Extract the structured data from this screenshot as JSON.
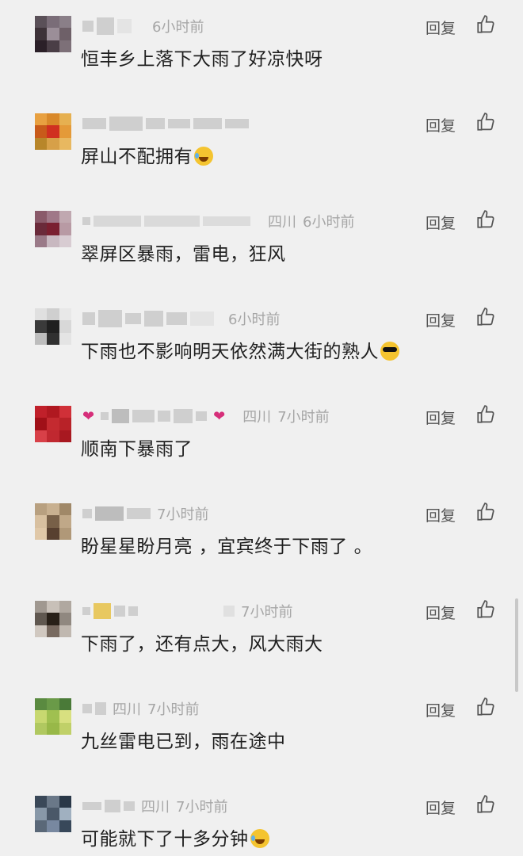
{
  "reply_label": "回复",
  "like_icon": "thumbs-up-icon",
  "comments": [
    {
      "location": "",
      "time": "6小时前",
      "text": "恒丰乡上落下大雨了好凉快呀",
      "emoji": ""
    },
    {
      "location": "",
      "time": "",
      "text": "屏山不配拥有",
      "emoji": "laugh-cry"
    },
    {
      "location": "四川",
      "time": "6小时前",
      "text": "翠屏区暴雨，雷电，狂风",
      "emoji": ""
    },
    {
      "location": "",
      "time": "6小时前",
      "text": "下雨也不影响明天依然满大街的熟人",
      "emoji": "sunglasses"
    },
    {
      "location": "四川",
      "time": "7小时前",
      "text": "顺南下暴雨了",
      "emoji": ""
    },
    {
      "location": "",
      "time": "7小时前",
      "text": "盼星星盼月亮 ，宜宾终于下雨了 。",
      "emoji": ""
    },
    {
      "location": "",
      "time": "7小时前",
      "text": "下雨了，还有点大，风大雨大",
      "emoji": ""
    },
    {
      "location": "四川",
      "time": "7小时前",
      "text": "九丝雷电已到，雨在途中",
      "emoji": ""
    },
    {
      "location": "四川",
      "time": "7小时前",
      "text": "可能就下了十多分钟",
      "emoji": "laugh-cry"
    }
  ]
}
